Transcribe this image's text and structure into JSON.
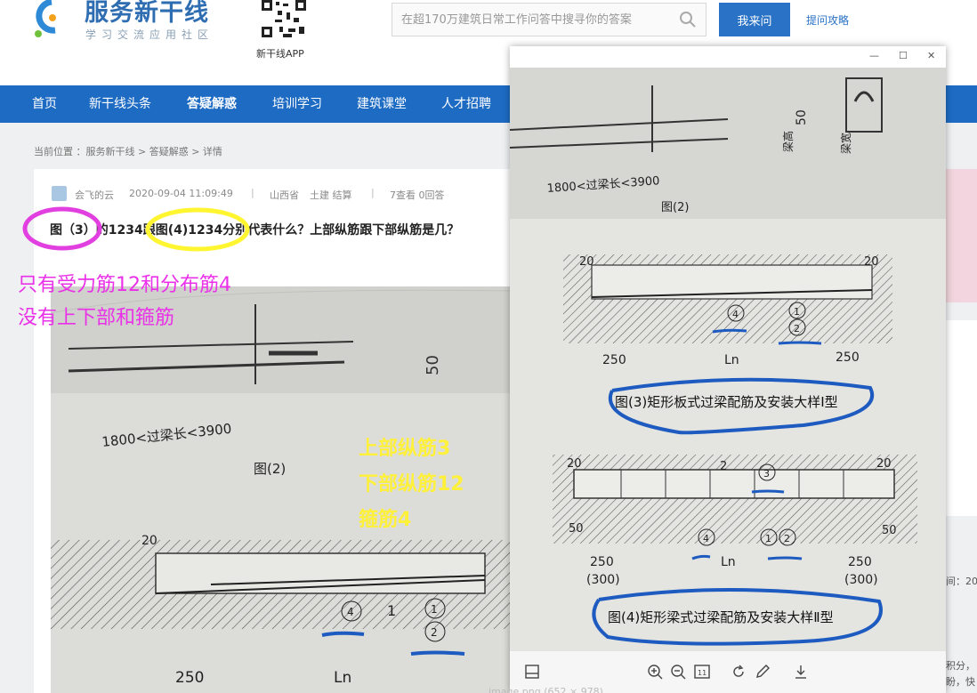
{
  "site": {
    "name": "服务新干线",
    "slogan": "学习交流应用社区",
    "app_label": "新干线APP",
    "search_placeholder": "在超170万建筑日常工作问答中搜寻你的答案",
    "ask_button": "我来问",
    "help_link": "提问攻略"
  },
  "nav": [
    "首页",
    "新干线头条",
    "答疑解惑",
    "培训学习",
    "建筑课堂",
    "人才招聘"
  ],
  "nav_active": "答疑解惑",
  "breadcrumb": "当前位置 ：服务新干线 > 答疑解惑 > 详情",
  "post": {
    "author": "会飞的云",
    "datetime": "2020-09-04 11:09:49",
    "sep": "|",
    "region": "山西省",
    "category": "土建 结算",
    "stats": "7查看 0回答",
    "question": "图（3）的1234跟图(4)1234分别代表什么？上部纵筋跟下部纵筋是几？"
  },
  "annotations": {
    "pink_line1": "只有受力筋12和分布筋4",
    "pink_line2": "没有上下部和箍筋",
    "yellow_line1": "上部纵筋3",
    "yellow_line2": "下部纵筋12",
    "yellow_line3": "箍筋4"
  },
  "drawing": {
    "beam_height_label": "梁高",
    "height_value": "50",
    "beam_width_label": "梁宽",
    "range_text": "1800<过梁长<3900",
    "fig2": "图(2)",
    "fig3": "图(3)矩形板式过梁配筋及安装大样Ⅰ型",
    "fig4": "图(4)矩形梁式过梁配筋及安装大样Ⅱ型",
    "dim_20": "20",
    "dim_250": "250",
    "dim_300": "(300)",
    "dim_ln": "Ln",
    "dim_50": "50",
    "bar_1": "1",
    "bar_2": "2",
    "bar_3": "3",
    "bar_4": "4",
    "sec_1": "1"
  },
  "right_edge": {
    "side_text1": "间：20",
    "side_text2": "积分，",
    "side_text3": "盼，快"
  },
  "viewer": {
    "min": "—",
    "max": "☐",
    "close": "✕"
  },
  "status": "image.png (652 × 978)"
}
